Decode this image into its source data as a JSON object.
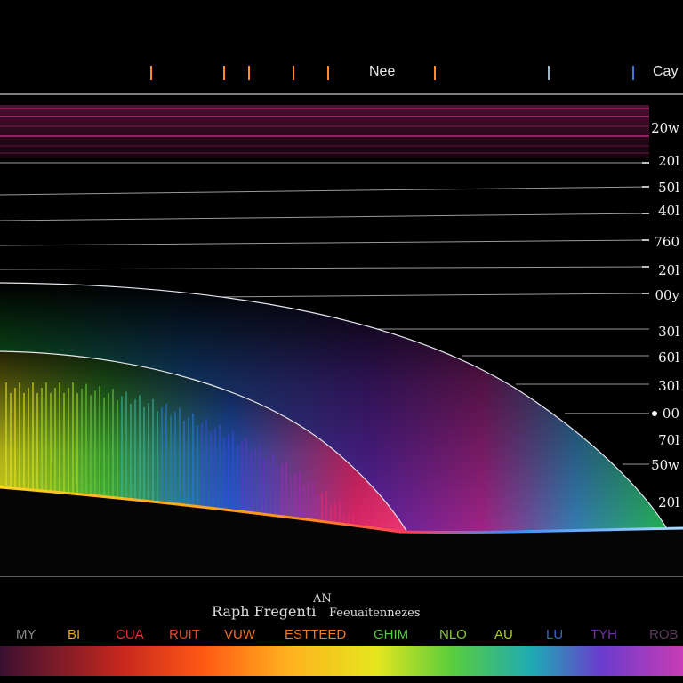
{
  "chart_data": {
    "type": "area",
    "title": "Raph Fregenti",
    "title_mark": "AN",
    "subtitle": "Feeuaitennezes",
    "top_labels": [
      "Nee",
      "Cay"
    ],
    "y_tick_labels": [
      "20w",
      "20l",
      "50l",
      "40l",
      "760",
      "20l",
      "00y",
      "30l",
      "60l",
      "30l",
      "00",
      "70l",
      "50w",
      "20l"
    ],
    "legend": [
      {
        "label": "MY",
        "color": "#8a8a8a"
      },
      {
        "label": "BI",
        "color": "#e6a51e"
      },
      {
        "label": "CUA",
        "color": "#e63232"
      },
      {
        "label": "RUIT",
        "color": "#e64628"
      },
      {
        "label": "VUW",
        "color": "#f06e1e"
      },
      {
        "label": "ESTTEED",
        "color": "#f0781e"
      },
      {
        "label": "GHIM",
        "color": "#5ac83c"
      },
      {
        "label": "NLO",
        "color": "#8cc83c"
      },
      {
        "label": "AU",
        "color": "#b4c828"
      },
      {
        "label": "LU",
        "color": "#3c64c8"
      },
      {
        "label": "TYH",
        "color": "#6e32a0"
      },
      {
        "label": "ROB",
        "color": "#5a3c5a"
      }
    ],
    "grid": true
  }
}
